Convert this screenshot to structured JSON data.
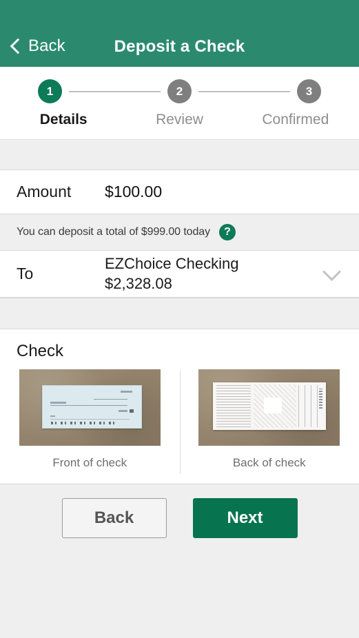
{
  "header": {
    "back_label": "Back",
    "title": "Deposit a Check",
    "back_icon": "chevron-left-icon",
    "background_color": "#2b8a6e"
  },
  "stepper": {
    "steps": [
      {
        "number": "1",
        "label": "Details",
        "state": "active"
      },
      {
        "number": "2",
        "label": "Review",
        "state": "inactive"
      },
      {
        "number": "3",
        "label": "Confirmed",
        "state": "inactive"
      }
    ],
    "active_color": "#0d7a58",
    "inactive_color": "#7f7f7f"
  },
  "form": {
    "amount": {
      "label": "Amount",
      "value": "$100.00"
    },
    "notice": {
      "text": "You can deposit a total of $999.00 today",
      "help_icon": "question-mark-icon",
      "help_icon_color": "#0d7a58"
    },
    "to": {
      "label": "To",
      "account_name": "EZChoice Checking",
      "account_balance": "$2,328.08",
      "dropdown_icon": "chevron-down-icon"
    }
  },
  "check": {
    "section_title": "Check",
    "front": {
      "caption": "Front of check",
      "image_name": "check-front-photo"
    },
    "back": {
      "caption": "Back of check",
      "image_name": "check-back-photo"
    }
  },
  "footer": {
    "back_label": "Back",
    "next_label": "Next",
    "next_color": "#07734f"
  }
}
